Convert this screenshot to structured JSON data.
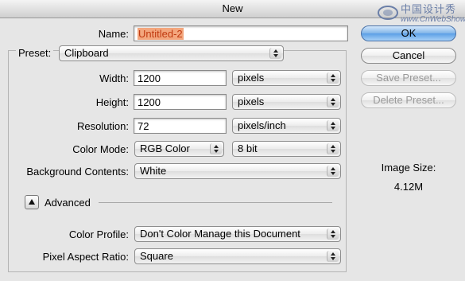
{
  "window": {
    "title": "New"
  },
  "watermark": {
    "text_zh": "中国设计秀",
    "text_en": "www.CnWebShow.com"
  },
  "name": {
    "label": "Name:",
    "value": "Untitled-2"
  },
  "preset": {
    "label": "Preset:",
    "value": "Clipboard"
  },
  "width": {
    "label": "Width:",
    "value": "1200",
    "unit": "pixels"
  },
  "height": {
    "label": "Height:",
    "value": "1200",
    "unit": "pixels"
  },
  "resolution": {
    "label": "Resolution:",
    "value": "72",
    "unit": "pixels/inch"
  },
  "color_mode": {
    "label": "Color Mode:",
    "value": "RGB Color",
    "depth": "8 bit"
  },
  "background": {
    "label": "Background Contents:",
    "value": "White"
  },
  "advanced": {
    "label": "Advanced"
  },
  "color_profile": {
    "label": "Color Profile:",
    "value": "Don't Color Manage this Document"
  },
  "pixel_aspect": {
    "label": "Pixel Aspect Ratio:",
    "value": "Square"
  },
  "buttons": {
    "ok": "OK",
    "cancel": "Cancel",
    "save_preset": "Save Preset...",
    "delete_preset": "Delete Preset..."
  },
  "image_size": {
    "label": "Image Size:",
    "value": "4.12M"
  },
  "colors": {
    "default_button": "#5b9ee6",
    "highlight": "#f3a67d"
  }
}
